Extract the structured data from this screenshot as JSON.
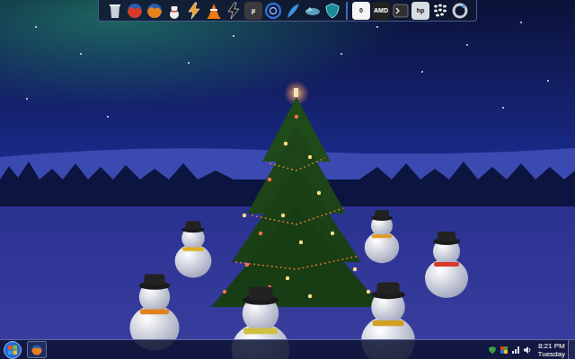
{
  "dock": {
    "items": [
      {
        "kind": "bin",
        "color": "#c8d0da"
      },
      {
        "kind": "globe",
        "color": "#d83a2a"
      },
      {
        "kind": "globe",
        "color": "#e8801c"
      },
      {
        "kind": "snowman",
        "color": "#f0f0f0"
      },
      {
        "kind": "bolt",
        "color": "#f0a020"
      },
      {
        "kind": "cone",
        "color": "#f07a10"
      },
      {
        "kind": "bolt",
        "color": "#202020"
      },
      {
        "kind": "badge",
        "color": "#3a3a3a",
        "text": "µ"
      },
      {
        "kind": "swirl",
        "color": "#3070d0"
      },
      {
        "kind": "feather",
        "color": "#4090e0"
      },
      {
        "kind": "bird",
        "color": "#5aa0b8"
      },
      {
        "kind": "shield",
        "color": "#1a8a9a"
      },
      {
        "kind": "separator",
        "color": "#3a70c0"
      },
      {
        "kind": "badge",
        "color": "#f4f4f4",
        "text": "0"
      },
      {
        "kind": "badge",
        "color": "#222222",
        "text": "AMD"
      },
      {
        "kind": "console",
        "color": "#303030"
      },
      {
        "kind": "badge",
        "color": "#d8dde4",
        "text": "hp"
      },
      {
        "kind": "dots",
        "color": "#f0f0f0"
      },
      {
        "kind": "ring",
        "color": "#c8d0da"
      }
    ]
  },
  "taskbar": {
    "buttons": [
      {
        "app": "firefox",
        "selected": false
      }
    ],
    "tray": [
      {
        "kind": "shield"
      },
      {
        "kind": "flag"
      },
      {
        "kind": "network"
      },
      {
        "kind": "volume"
      }
    ],
    "clock": {
      "time": "8:21 PM",
      "day": "Tuesday"
    }
  }
}
